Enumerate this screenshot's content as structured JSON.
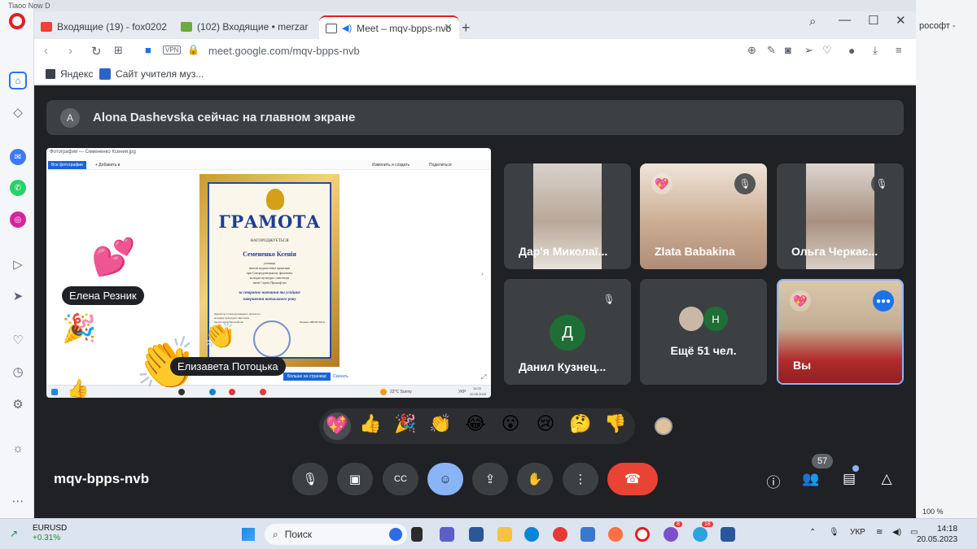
{
  "browser": {
    "tab_partial": "Tiaoo Now D...",
    "tabs": [
      {
        "label": "Входящие (19) - fox0202"
      },
      {
        "label": "(102) Входящие • merzar"
      },
      {
        "label": "Meet – mqv-bpps-nvb"
      }
    ],
    "vpn_label": "VPN",
    "url": "meet.google.com/mqv-bpps-nvb",
    "bookmarks": [
      {
        "label": "Яндекс"
      },
      {
        "label": "Сайт учителя муз..."
      }
    ]
  },
  "background_window": {
    "title_fragment": "рософт -",
    "zoom": "100 %"
  },
  "meet": {
    "presenting_banner": {
      "avatar_letter": "A",
      "text": "Alona Dashevska сейчас на главном экране"
    },
    "shared_screen": {
      "window_title": "Фотографии — Семененко Ксения.jpg",
      "all_photos_btn": "Все фотографии",
      "add_btn": "+ Добавить в",
      "edit_btn": "Изменить и создать",
      "share_btn": "Поделиться",
      "certificate": {
        "title": "ГРАМОТА",
        "awarded": "НАГОРОДЖУЄТЬСЯ",
        "name": "Семененко Ксенія",
        "desc": [
          "учениця",
          "школи педагогічної практики",
          "при Сєвєродонецькому фаховому",
          "коледжі культури і мистецтв",
          "імені Сергія Прокоф'єва"
        ],
        "reason": [
          "за старанне навчання та успішне",
          "завершення навчального року"
        ],
        "sign": [
          "Директор Сєвєродонецького фахового",
          "коледжу культури і мистецтв",
          "імені Сергія Прокоф'єва"
        ],
        "signer": "Марина ЯВОРСЬКА"
      },
      "blue_btn": "Больше на странице",
      "link": "Скачать",
      "weather": "22°C Sunny",
      "lang": "УКР",
      "time": "14:22",
      "date": "20.05.2023"
    },
    "overlay_names": [
      "Елена Резник",
      "Елизавета Потоцька"
    ],
    "tiles": [
      {
        "name": "Дар'я Миколаї..."
      },
      {
        "name": "Zlata Babakina"
      },
      {
        "name": "Ольга Черкас..."
      },
      {
        "name": "Данил Кузнец...",
        "avatar_letter": "Д"
      },
      {
        "name": "Ещё 51 чел.",
        "mini_letter": "Н"
      },
      {
        "name": "Вы"
      }
    ],
    "reactions": [
      "💖",
      "👍",
      "🎉",
      "👏",
      "😂",
      "😮",
      "😢",
      "🤔",
      "👎"
    ],
    "meeting_code": "mqv-bpps-nvb",
    "participants_count": "57",
    "colors": {
      "bg": "#202124",
      "tile": "#3c4043",
      "end_call": "#ea4335",
      "accent": "#8ab4f8"
    }
  },
  "taskbar": {
    "ticker_symbol": "EURUSD",
    "ticker_change": "+0.31%",
    "search_label": "Поиск",
    "lang": "УКР",
    "time": "14:18",
    "date": "20.05.2023",
    "badges": [
      "8",
      "18"
    ]
  }
}
